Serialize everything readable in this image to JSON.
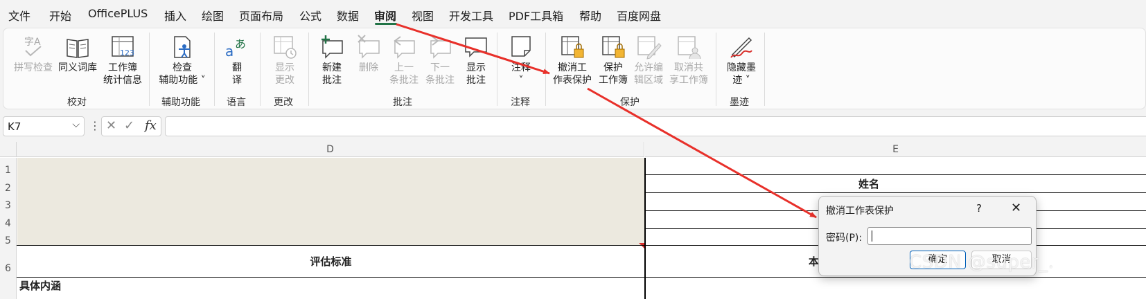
{
  "menu": [
    "文件",
    "开始",
    "OfficePLUS",
    "插入",
    "绘图",
    "页面布局",
    "公式",
    "数据",
    "审阅",
    "视图",
    "开发工具",
    "PDF工具箱",
    "帮助",
    "百度网盘"
  ],
  "menu_active": "审阅",
  "ribbon": {
    "spell_check": "拼写检查",
    "thesaurus": "同义词库",
    "workbook_stats_1": "工作簿",
    "workbook_stats_2": "统计信息",
    "group_proofing": "校对",
    "check_access_1": "检查",
    "check_access_2": "辅助功能 ˅",
    "group_accessibility": "辅助功能",
    "translate_1": "翻",
    "translate_2": "译",
    "group_language": "语言",
    "show_changes_1": "显示",
    "show_changes_2": "更改",
    "group_changes": "更改",
    "new_comment_1": "新建",
    "new_comment_2": "批注",
    "delete": "删除",
    "prev_comment_1": "上一",
    "prev_comment_2": "条批注",
    "next_comment_1": "下一",
    "next_comment_2": "条批注",
    "show_comments_1": "显示",
    "show_comments_2": "批注",
    "group_comments": "批注",
    "notes_1": "注释",
    "notes_2": "˅",
    "group_notes": "注释",
    "unprotect_sheet_1": "撤消工",
    "unprotect_sheet_2": "作表保护",
    "protect_workbook_1": "保护",
    "protect_workbook_2": "工作簿",
    "allow_edit_1": "允许编",
    "allow_edit_2": "辑区域",
    "unshare_1": "取消共",
    "unshare_2": "享工作簿",
    "group_protect": "保护",
    "hide_ink_1": "隐藏墨",
    "hide_ink_2": "迹 ˅",
    "group_ink": "墨迹"
  },
  "formula_bar": {
    "name_box": "K7",
    "cancel": "✕",
    "enter": "✓",
    "fx": "fx",
    "content": ""
  },
  "sheet": {
    "col_d": "D",
    "col_e": "E",
    "rows": [
      "1",
      "2",
      "3",
      "4",
      "5",
      "6"
    ],
    "e2": "姓名",
    "d6": "评估标准",
    "e6_partial": "本",
    "d7_partial": "具体内涵",
    "merged_fill": "#ece9df"
  },
  "dialog": {
    "title": "撤消工作表保护",
    "help": "?",
    "close": "✕",
    "password_label": "密码(P):",
    "password_value": "",
    "ok": "确定",
    "cancel": "取消"
  },
  "watermark": "CSDN @super_.",
  "colors": {
    "accent": "#217346",
    "arrow": "#e8302a"
  }
}
